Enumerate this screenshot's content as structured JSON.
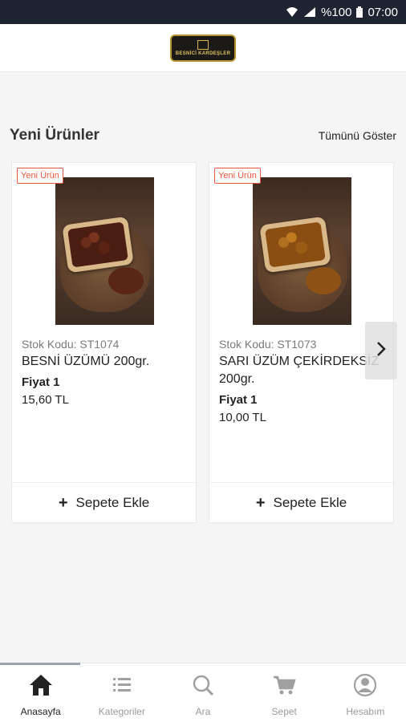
{
  "status_bar": {
    "battery": "%100",
    "time": "07:00"
  },
  "header": {
    "logo_text": "BESNİCİ KARDEŞLER"
  },
  "section": {
    "title": "Yeni Ürünler",
    "show_all": "Tümünü Göster"
  },
  "products": [
    {
      "badge": "Yeni Ürün",
      "stock_code": "Stok Kodu: ST1074",
      "name": "BESNİ ÜZÜMÜ 200gr.",
      "price_label": "Fiyat 1",
      "price": "15,60 TL",
      "add_label": "Sepete Ekle"
    },
    {
      "badge": "Yeni Ürün",
      "stock_code": "Stok Kodu: ST1073",
      "name": "SARI ÜZÜM ÇEKİRDEKSİZ 200gr.",
      "price_label": "Fiyat 1",
      "price": "10,00 TL",
      "add_label": "Sepete Ekle"
    }
  ],
  "bottom_nav": {
    "items": [
      {
        "label": "Anasayfa",
        "icon": "home-icon",
        "active": true
      },
      {
        "label": "Kategoriler",
        "icon": "list-icon",
        "active": false
      },
      {
        "label": "Ara",
        "icon": "search-icon",
        "active": false
      },
      {
        "label": "Sepet",
        "icon": "cart-icon",
        "active": false
      },
      {
        "label": "Hesabım",
        "icon": "account-icon",
        "active": false
      }
    ]
  },
  "colors": {
    "status_bar": "#1f2433",
    "badge": "#e8563f",
    "background": "#f5f5f5"
  }
}
